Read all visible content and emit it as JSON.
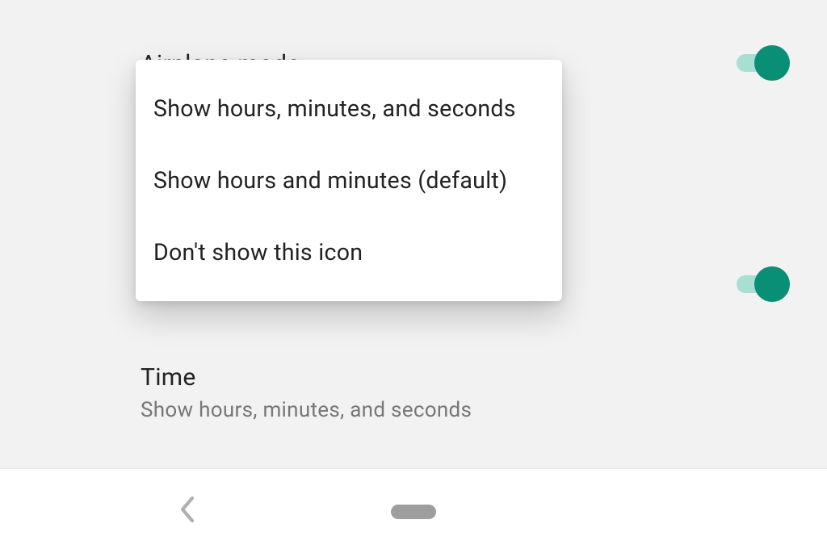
{
  "settings": {
    "section_header": "Airplane mode",
    "toggle_1_on": true,
    "toggle_2_on": true
  },
  "time_item": {
    "title": "Time",
    "subtitle": "Show hours, minutes, and seconds"
  },
  "menu": {
    "items": [
      {
        "label": "Show hours, minutes, and seconds"
      },
      {
        "label": "Show hours and minutes (default)"
      },
      {
        "label": "Don't show this icon"
      }
    ]
  },
  "colors": {
    "toggle_on_thumb": "#0a8f77",
    "toggle_on_track": "#a7dfd2",
    "background": "#f2f2f2"
  }
}
